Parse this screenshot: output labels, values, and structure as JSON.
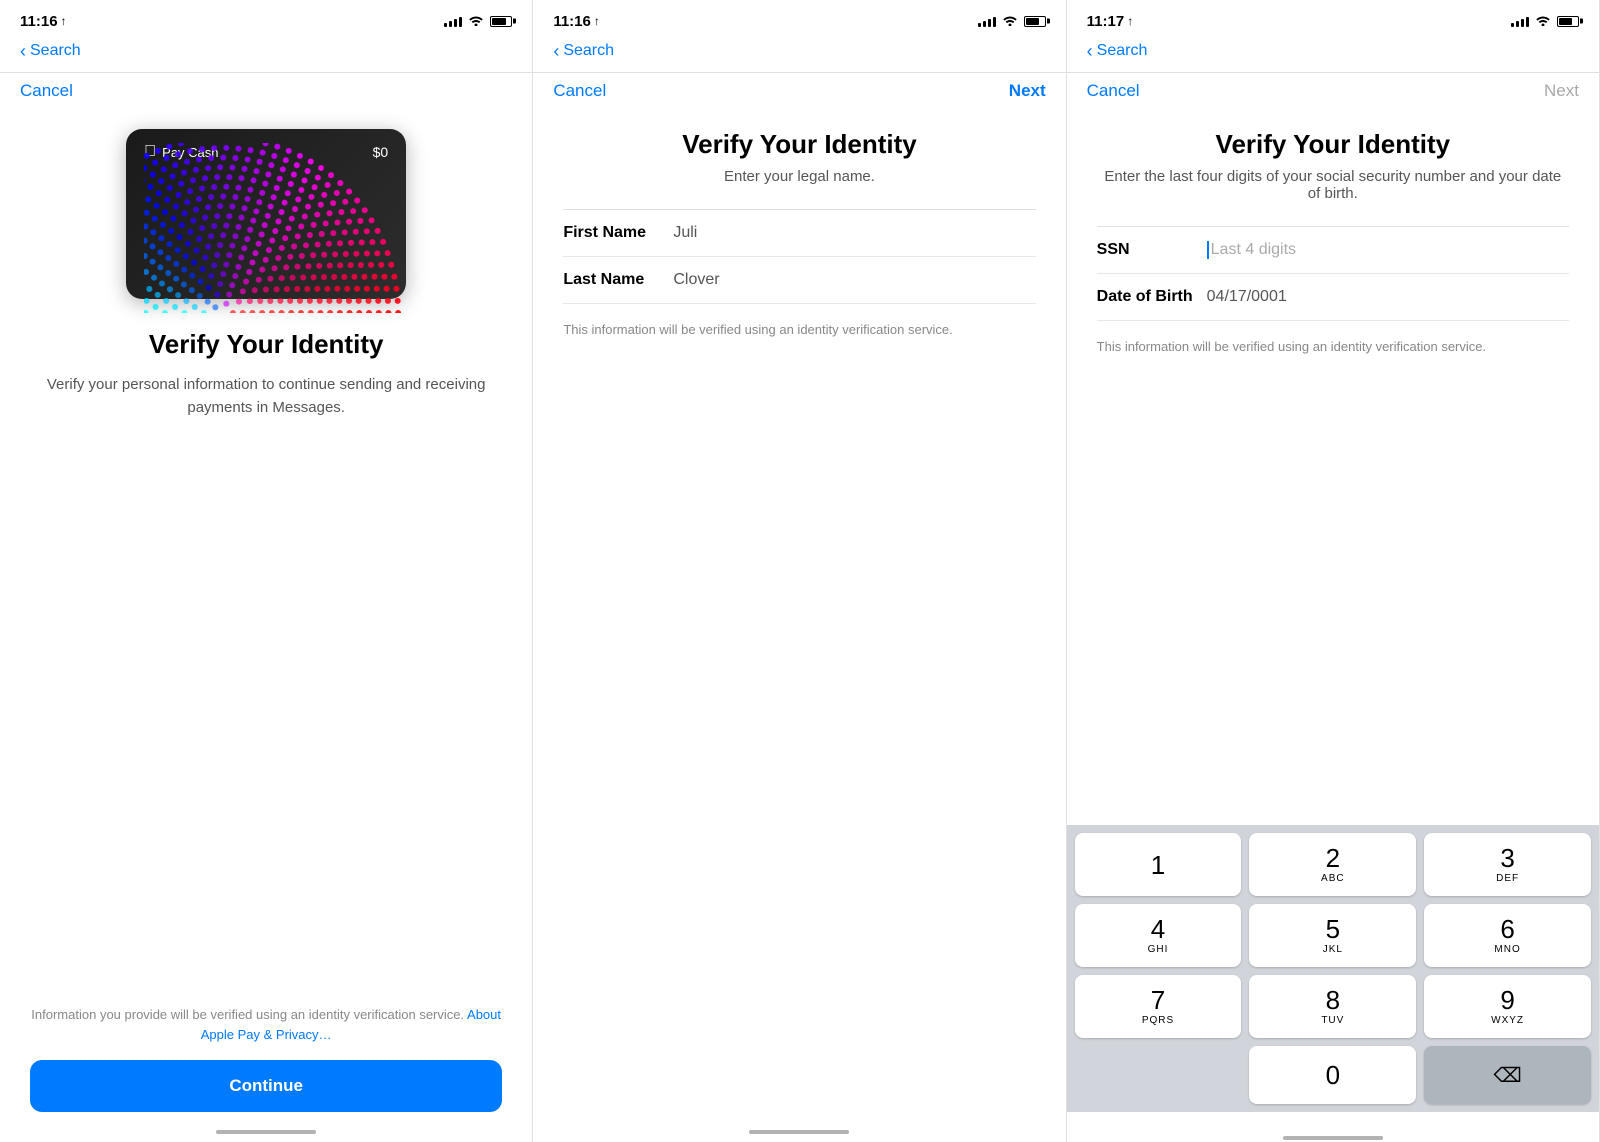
{
  "panel1": {
    "status": {
      "time": "11:16",
      "location_arrow": "↑"
    },
    "nav": {
      "back_label": "Search",
      "cancel_label": "Cancel"
    },
    "card": {
      "logo": "Pay Cash",
      "amount": "$0"
    },
    "title": "Verify Your Identity",
    "subtitle": "Verify your personal information to continue sending and receiving payments in Messages.",
    "privacy_text": "Information you provide will be verified using an identity verification service.",
    "privacy_link": "About Apple Pay & Privacy…",
    "continue_label": "Continue"
  },
  "panel2": {
    "status": {
      "time": "11:16",
      "location_arrow": "↑"
    },
    "nav": {
      "back_label": "Search",
      "cancel_label": "Cancel",
      "next_label": "Next"
    },
    "title": "Verify Your Identity",
    "subtitle": "Enter your legal name.",
    "fields": [
      {
        "label": "First Name",
        "value": "Juli"
      },
      {
        "label": "Last Name",
        "value": "Clover"
      }
    ],
    "note": "This information will be verified using an identity verification service."
  },
  "panel3": {
    "status": {
      "time": "11:17",
      "location_arrow": "↑"
    },
    "nav": {
      "back_label": "Search",
      "cancel_label": "Cancel",
      "next_label": "Next"
    },
    "title": "Verify Your Identity",
    "subtitle": "Enter the last four digits of your social security number and your date of birth.",
    "fields": [
      {
        "label": "SSN",
        "placeholder": "Last 4 digits",
        "value": ""
      },
      {
        "label": "Date of Birth",
        "value": "04/17/0001"
      }
    ],
    "note": "This information will be verified using an identity verification service.",
    "numpad": {
      "keys": [
        {
          "digit": "1",
          "letters": ""
        },
        {
          "digit": "2",
          "letters": "ABC"
        },
        {
          "digit": "3",
          "letters": "DEF"
        },
        {
          "digit": "4",
          "letters": "GHI"
        },
        {
          "digit": "5",
          "letters": "JKL"
        },
        {
          "digit": "6",
          "letters": "MNO"
        },
        {
          "digit": "7",
          "letters": "PQRS"
        },
        {
          "digit": "8",
          "letters": "TUV"
        },
        {
          "digit": "9",
          "letters": "WXYZ"
        }
      ],
      "zero": "0",
      "delete_icon": "⌫"
    }
  }
}
